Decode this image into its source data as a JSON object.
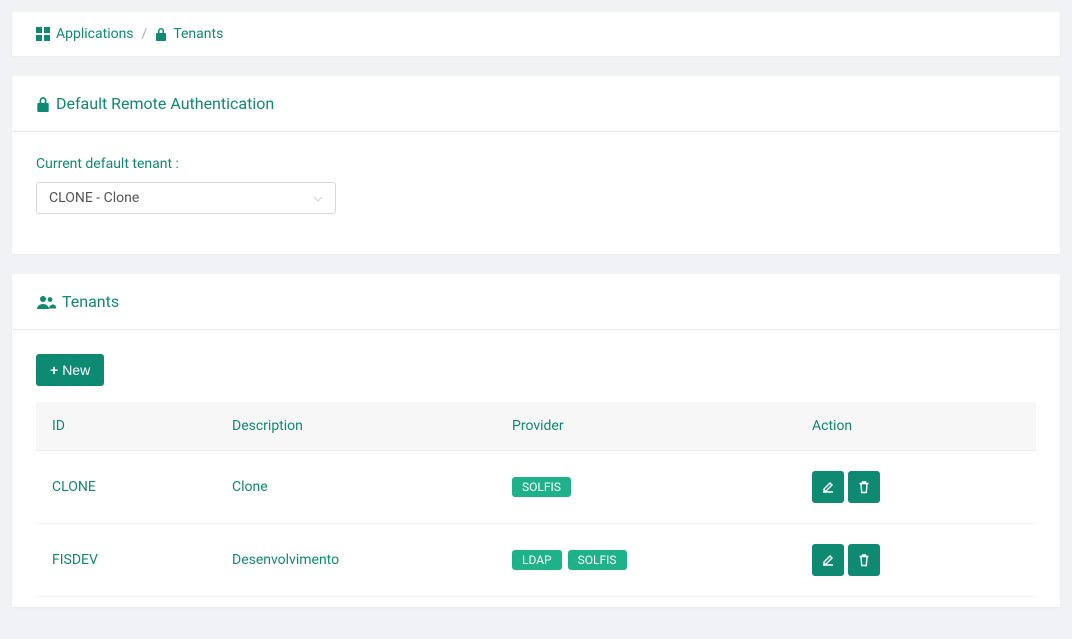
{
  "breadcrumb": {
    "applications": "Applications",
    "tenants": "Tenants"
  },
  "defaultAuth": {
    "title": "Default Remote Authentication",
    "label": "Current default tenant :",
    "selected": "CLONE - Clone"
  },
  "tenantsPanel": {
    "title": "Tenants",
    "newButton": "New",
    "columns": {
      "id": "ID",
      "description": "Description",
      "provider": "Provider",
      "action": "Action"
    },
    "rows": [
      {
        "id": "CLONE",
        "description": "Clone",
        "providers": [
          "SOLFIS"
        ]
      },
      {
        "id": "FISDEV",
        "description": "Desenvolvimento",
        "providers": [
          "LDAP",
          "SOLFIS"
        ]
      }
    ]
  }
}
